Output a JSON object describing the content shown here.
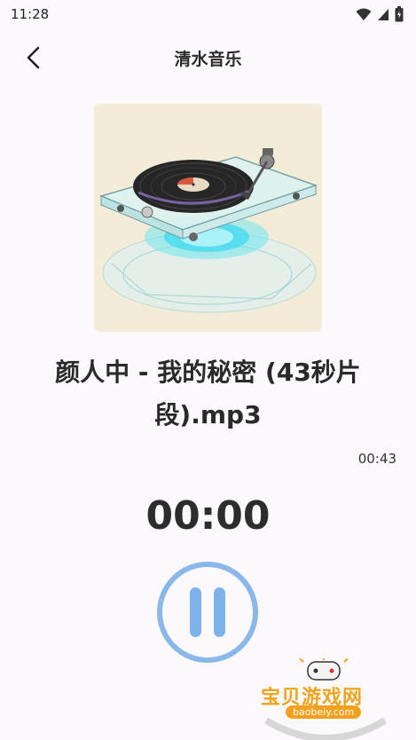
{
  "status_bar": {
    "time": "11:28",
    "icons": [
      "wifi-icon",
      "signal-icon",
      "battery-icon"
    ]
  },
  "app_bar": {
    "title": "清水音乐",
    "back_icon": "back-arrow-icon"
  },
  "track": {
    "title": "颜人中 - 我的秘密 (43秒片段).mp3",
    "duration": "00:43",
    "elapsed": "00:00",
    "state_icon": "pause-icon"
  },
  "watermark": {
    "text": "宝贝游戏网",
    "url": "baobeiy.com"
  },
  "colors": {
    "background": "#fcf9fd",
    "accent": "#7db2ea"
  }
}
